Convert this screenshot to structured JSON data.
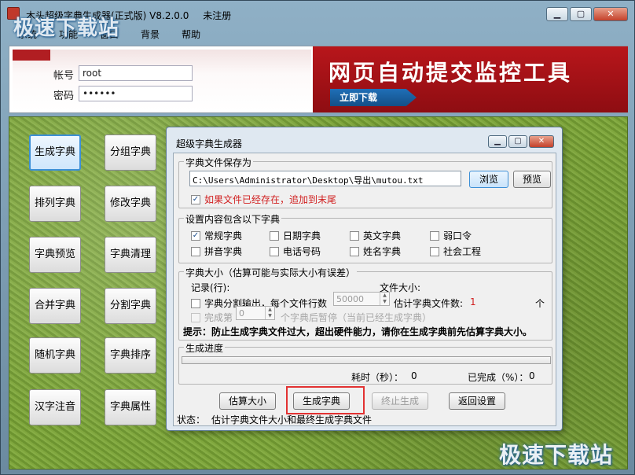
{
  "window": {
    "title": "木头超级字典生成器(正式版) V8.2.0.0",
    "registration": "未注册",
    "app_icon_text": "",
    "watermark": "极速下载站"
  },
  "menu": [
    "系统",
    "功能",
    "窗口",
    "背景",
    "帮助"
  ],
  "login": {
    "logo_text": "",
    "account_label": "帐号",
    "account_value": "root",
    "password_label": "密码",
    "password_value": "••••••"
  },
  "ad": {
    "headline": "网页自动提交监控工具",
    "button": "立即下载"
  },
  "sidebar": {
    "left": [
      "生成字典",
      "排列字典",
      "字典预览",
      "合并字典",
      "随机字典",
      "汉字注音"
    ],
    "right": [
      "分组字典",
      "修改字典",
      "字典清理",
      "分割字典",
      "字典排序",
      "字典属性"
    ]
  },
  "dialog": {
    "title": "超级字典生成器",
    "save": {
      "legend": "字典文件保存为",
      "path": "C:\\Users\\Administrator\\Desktop\\导出\\mutou.txt",
      "browse": "浏览",
      "preview": "预览",
      "append_label": "如果文件已经存在，追加到末尾",
      "append_checked": true
    },
    "content": {
      "legend": "设置内容包含以下字典",
      "options": [
        {
          "label": "常规字典",
          "checked": true
        },
        {
          "label": "日期字典",
          "checked": false
        },
        {
          "label": "英文字典",
          "checked": false
        },
        {
          "label": "弱口令",
          "checked": false
        },
        {
          "label": "拼音字典",
          "checked": false
        },
        {
          "label": "电话号码",
          "checked": false
        },
        {
          "label": "姓名字典",
          "checked": false
        },
        {
          "label": "社会工程",
          "checked": false
        }
      ]
    },
    "size": {
      "legend": "字典大小（估算可能与实际大小有误差）",
      "records_label": "记录(行):",
      "filesize_label": "文件大小:",
      "split_label": "字典分割输出，每个文件行数",
      "split_value": "50000",
      "estimate_label": "估计字典文件数:",
      "estimate_value": "1",
      "estimate_unit": "个",
      "done_label": "完成第",
      "done_value": "0",
      "done_suffix": "个字典后暂停（当前已经生成字典）",
      "tip": "提示：防止生成字典文件过大，超出硬件能力，请你在生成字典前先估算字典大小。"
    },
    "progress": {
      "legend": "生成进度",
      "fraction": 0.0,
      "elapsed_label": "耗时（秒）：",
      "elapsed_value": "0",
      "done_label": "已完成（%）：",
      "done_value": "0"
    },
    "buttons": {
      "estimate": "估算大小",
      "generate": "生成字典",
      "stop": "终止生成",
      "back": "返回设置"
    },
    "status": {
      "label": "状态：",
      "text": "估计字典文件大小和最终生成字典文件"
    }
  }
}
